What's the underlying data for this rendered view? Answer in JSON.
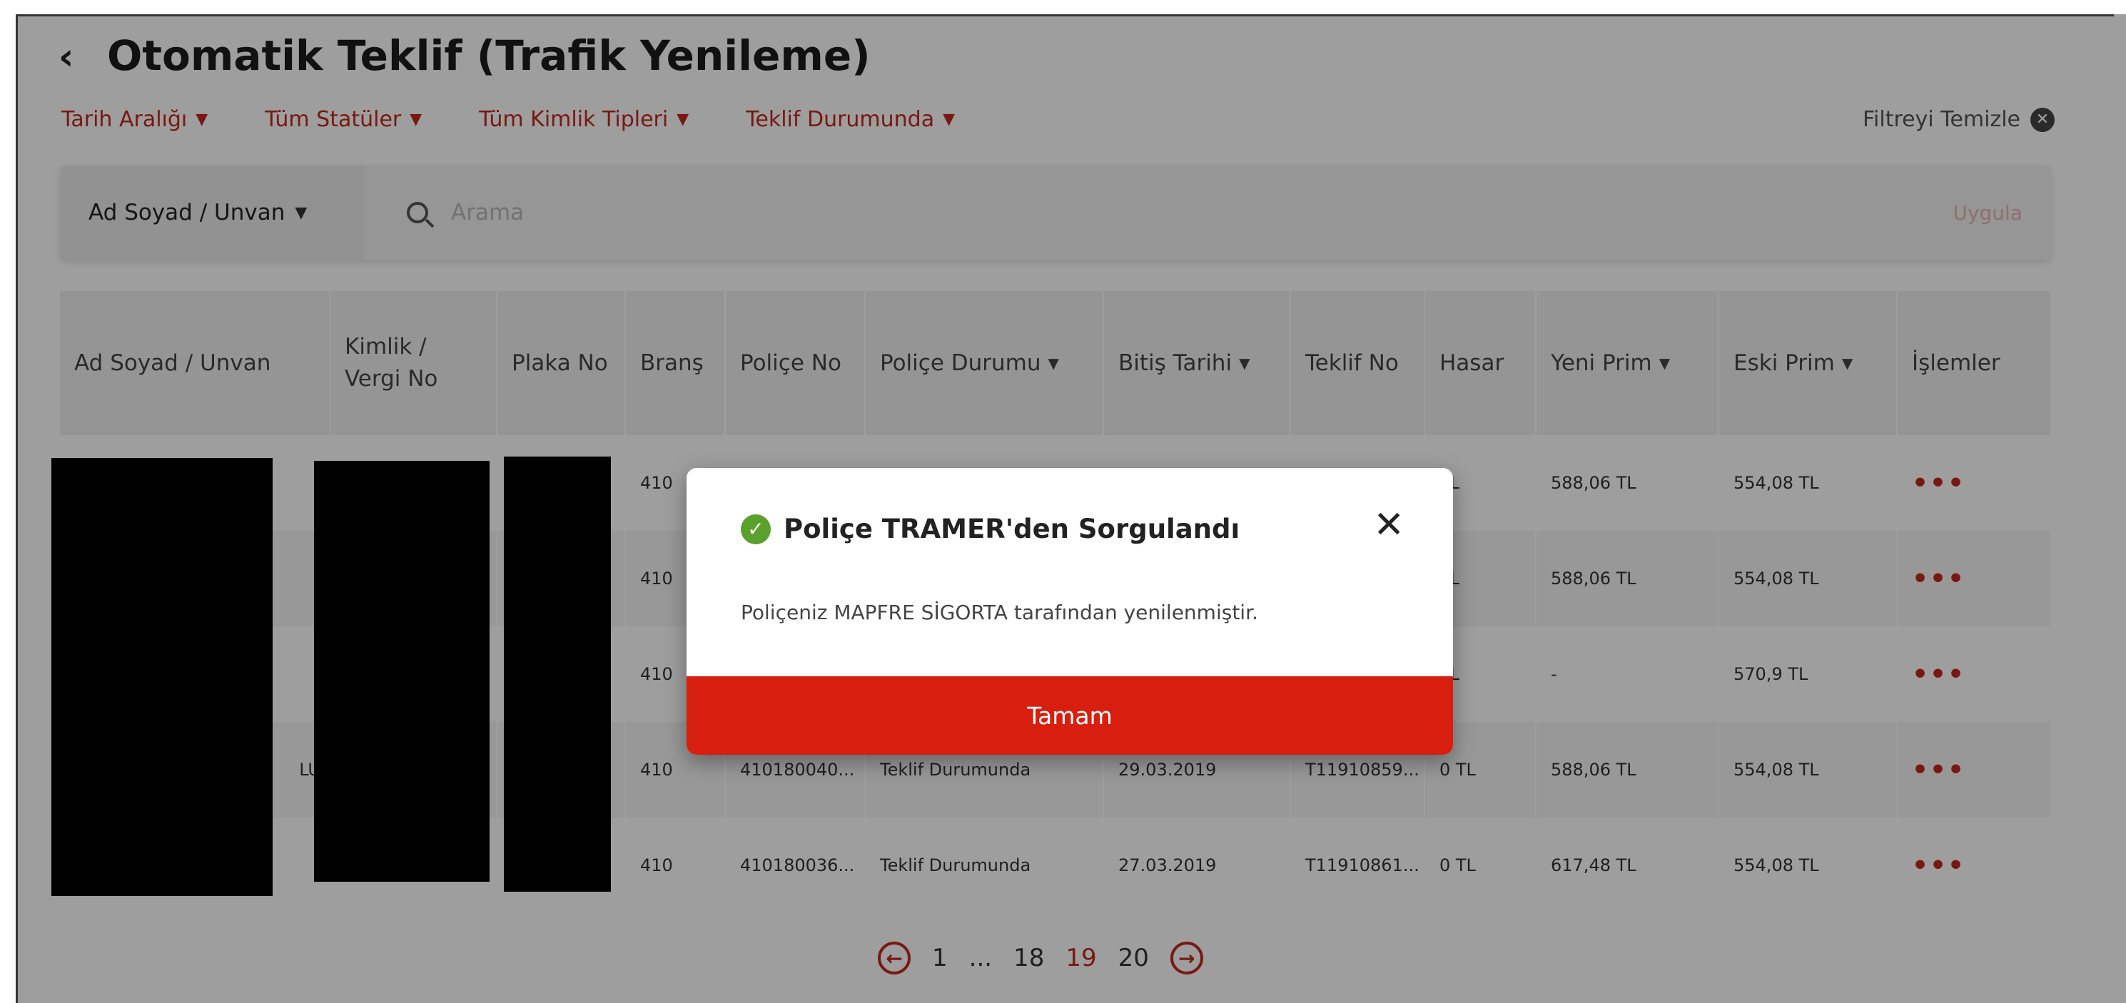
{
  "header": {
    "back_icon": "chevron-left-icon",
    "title": "Otomatik Teklif (Trafik Yenileme)"
  },
  "filters": {
    "items": [
      {
        "label": "Tarih Aralığı"
      },
      {
        "label": "Tüm Statüler"
      },
      {
        "label": "Tüm Kimlik Tipleri"
      },
      {
        "label": "Teklif Durumunda"
      }
    ],
    "clear_label": "Filtreyi Temizle"
  },
  "search": {
    "field_select": "Ad Soyad / Unvan",
    "placeholder": "Arama",
    "apply_label": "Uygula"
  },
  "table": {
    "columns": [
      {
        "label": "Ad Soyad / Unvan"
      },
      {
        "label": "Kimlik / Vergi No"
      },
      {
        "label": "Plaka No"
      },
      {
        "label": "Branş"
      },
      {
        "label": "Poliçe No"
      },
      {
        "label": "Poliçe Durumu"
      },
      {
        "label": "Bitiş Tarihi"
      },
      {
        "label": "Teklif No"
      },
      {
        "label": "Hasar"
      },
      {
        "label": "Yeni Prim"
      },
      {
        "label": "Eski Prim"
      },
      {
        "label": "İşlemler"
      }
    ],
    "rows": [
      {
        "name": "",
        "kimlik": "",
        "plaka": "",
        "brans": "410",
        "police_no": "",
        "durum": "",
        "bitis": "",
        "teklif_no": "",
        "hasar": "TL",
        "yeni_prim": "588,06 TL",
        "eski_prim": "554,08 TL",
        "islem": "•••"
      },
      {
        "name": "",
        "kimlik": "",
        "plaka": "",
        "brans": "410",
        "police_no": "",
        "durum": "",
        "bitis": "",
        "teklif_no": "",
        "hasar": "TL",
        "yeni_prim": "588,06 TL",
        "eski_prim": "554,08 TL",
        "islem": "•••"
      },
      {
        "name": "",
        "kimlik": "",
        "plaka": "",
        "brans": "410",
        "police_no": "",
        "durum": "",
        "bitis": "",
        "teklif_no": "",
        "hasar": "TL",
        "yeni_prim": "-",
        "eski_prim": "570,9 TL",
        "islem": "•••"
      },
      {
        "name": "LU",
        "kimlik": "",
        "plaka": "",
        "brans": "410",
        "police_no": "410180040...",
        "durum": "Teklif Durumunda",
        "bitis": "29.03.2019",
        "teklif_no": "T11910859...",
        "hasar": "0 TL",
        "yeni_prim": "588,06 TL",
        "eski_prim": "554,08 TL",
        "islem": "•••"
      },
      {
        "name": "",
        "kimlik": "",
        "plaka": "",
        "brans": "410",
        "police_no": "410180036...",
        "durum": "Teklif Durumunda",
        "bitis": "27.03.2019",
        "teklif_no": "T11910861...",
        "hasar": "0 TL",
        "yeni_prim": "617,48 TL",
        "eski_prim": "554,08 TL",
        "islem": "•••"
      }
    ]
  },
  "pagination": {
    "pages": [
      "1",
      "...",
      "18",
      "19",
      "20"
    ],
    "current": "19"
  },
  "modal": {
    "title": "Poliçe TRAMER'den Sorgulandı",
    "message": "Poliçeniz MAPFRE SİGORTA tarafından yenilenmiştir.",
    "button_label": "Tamam"
  },
  "colors": {
    "accent": "#c4281c",
    "button": "#d81e0e",
    "success": "#5aa02c"
  }
}
